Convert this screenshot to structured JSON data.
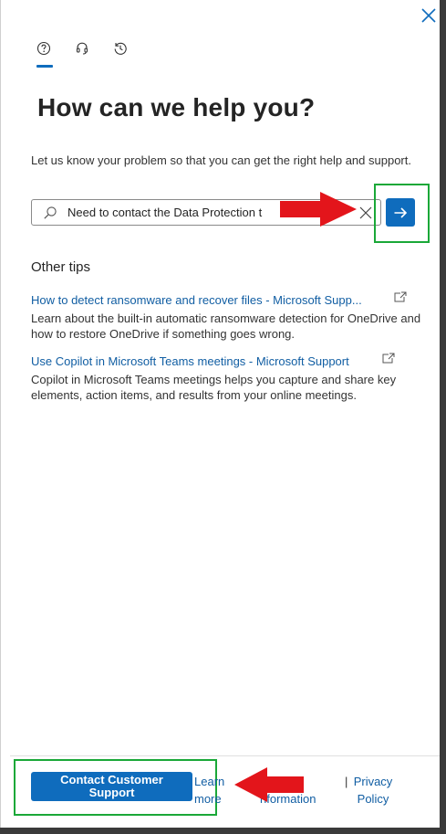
{
  "tabs": [
    {
      "icon": "help-icon",
      "active": true
    },
    {
      "icon": "headset-icon",
      "active": false
    },
    {
      "icon": "history-icon",
      "active": false
    }
  ],
  "title": "How can we help you?",
  "intro": "Let us know your problem so that you can get the right help and support.",
  "search": {
    "value": "Need to contact the Data Protection t",
    "clear_icon": "close-icon",
    "submit_icon": "arrow-right-icon"
  },
  "tips_heading": "Other tips",
  "tips": [
    {
      "title": "How to detect ransomware and recover files - Microsoft Supp...",
      "description": "Learn about the built-in automatic ransomware detection for OneDrive and how to restore OneDrive if something goes wrong."
    },
    {
      "title": "Use Copilot in Microsoft Teams meetings - Microsoft Support",
      "description": "Copilot in Microsoft Teams meetings helps you capture and share key elements, action items, and results from your online meetings."
    }
  ],
  "footer": {
    "contact_button": "Contact Customer Support",
    "learn_more": "Learn more",
    "information": "nformation",
    "separator": "|",
    "privacy": "Privacy Policy"
  },
  "colors": {
    "accent": "#0f6cbd",
    "link": "#115ea3",
    "annotation_red": "#e3151b",
    "annotation_green": "#1aa838"
  }
}
